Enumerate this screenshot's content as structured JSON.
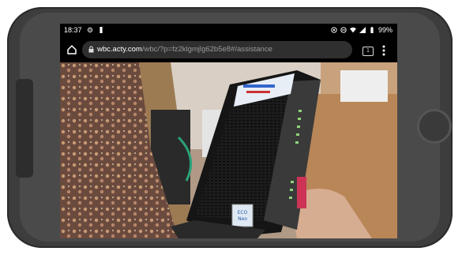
{
  "status_bar": {
    "time": "18:37",
    "battery": "99%",
    "icons": [
      "gear-icon",
      "battery-small-icon",
      "wifi-icon",
      "signal-icon",
      "battery-icon"
    ]
  },
  "browser": {
    "url_domain": "wbc.acty.com",
    "url_path": "/wbc/?p=fz2klgmjlg62b5e8#/assistance",
    "tab_count": "1"
  },
  "device_label": {
    "badge_line1": "ECO",
    "badge_line2": "Neo"
  }
}
